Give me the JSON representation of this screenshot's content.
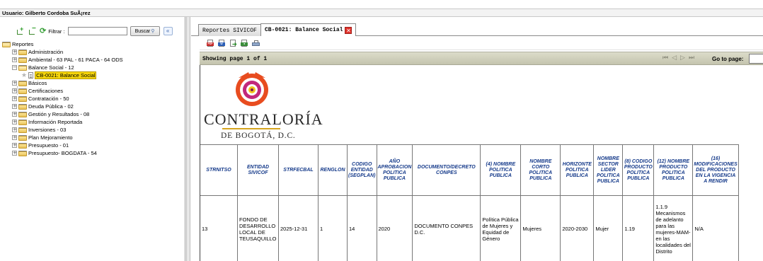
{
  "user_bar": {
    "label": "Usuario:",
    "name": "Gilberto Cordoba SuÃ¡rez"
  },
  "left_toolbar": {
    "filter_label": "Filtrar :",
    "filter_value": "",
    "search_button": "Buscar",
    "collapse_glyph": "«"
  },
  "tree": {
    "root": "Reportes",
    "items": [
      {
        "label": "Administración"
      },
      {
        "label": "Ambiental - 63 PAL - 61 PACA - 64 ODS"
      },
      {
        "label": "Balance Social - 12"
      },
      {
        "label": "CB-0021: Balance Social"
      },
      {
        "label": "Básicos"
      },
      {
        "label": "Certificaciones"
      },
      {
        "label": "Contratación - 50"
      },
      {
        "label": "Deuda Pública - 02"
      },
      {
        "label": "Gestión y Resultados - 08"
      },
      {
        "label": "Información Reportada"
      },
      {
        "label": "Inversiones - 03"
      },
      {
        "label": "Plan Mejoramiento"
      },
      {
        "label": "Presupuesto - 01"
      },
      {
        "label": "Presupuesto- BOGDATA - 54"
      }
    ]
  },
  "tabs": [
    {
      "label": "Reportes SIVICOF"
    },
    {
      "label": "CB-0021: Balance Social"
    }
  ],
  "pagebar": {
    "page_info": "Showing page  1  of  1",
    "goto_label": "Go to page:",
    "goto_value": ""
  },
  "report": {
    "brand": "CONTRALORÍA",
    "brand_sub": "DE BOGOTÁ, D.C.",
    "headers": [
      "STRNITSO",
      "ENTIDAD SIVICOF",
      "STRFECBAL",
      "RENGLON",
      "CODIGO ENTIDAD (SEGPLAN)",
      "AÑO APROBACION POLITICA PUBLICA",
      "DOCUMENTO/DECRETO CONPES",
      "(4) NOMBRE POLITICA PUBLICA",
      "NOMBRE CORTO POLITICA PUBLICA",
      "HORIZONTE POLITICA PUBLICA",
      "NOMBRE SECTOR LIDER POLITICA PUBLICA",
      "(8) CODIGO PRODUCTO POLITICA PUBLICA",
      "(12) NOMBRE PRODUCTO POLITICA PUBLICA",
      "(16) MODIFICACIONES DEL PRODUCTO EN LA VIGENCIA A RENDIR"
    ],
    "row": [
      "13",
      "FONDO DE DESARROLLO LOCAL DE TEUSAQUILLO",
      "2025-12-31",
      "1",
      "14",
      "2020",
      "DOCUMENTO CONPES D.C.",
      "Política Pública de Mujeres y Equidad de Género",
      "Mujeres",
      "2020-2030",
      "Mujer",
      "1.19",
      "1.1.9 Mecanismos de adelanto para las mujeres-MAM- en las localidades del Distrito",
      "N/A"
    ]
  },
  "colors": {
    "selected_highlight": "#f5d50b",
    "header_text": "#153a8a",
    "pagebar": "#d0d0bc",
    "brand_gold": "#d6a51f",
    "close_red": "#e0322b"
  }
}
